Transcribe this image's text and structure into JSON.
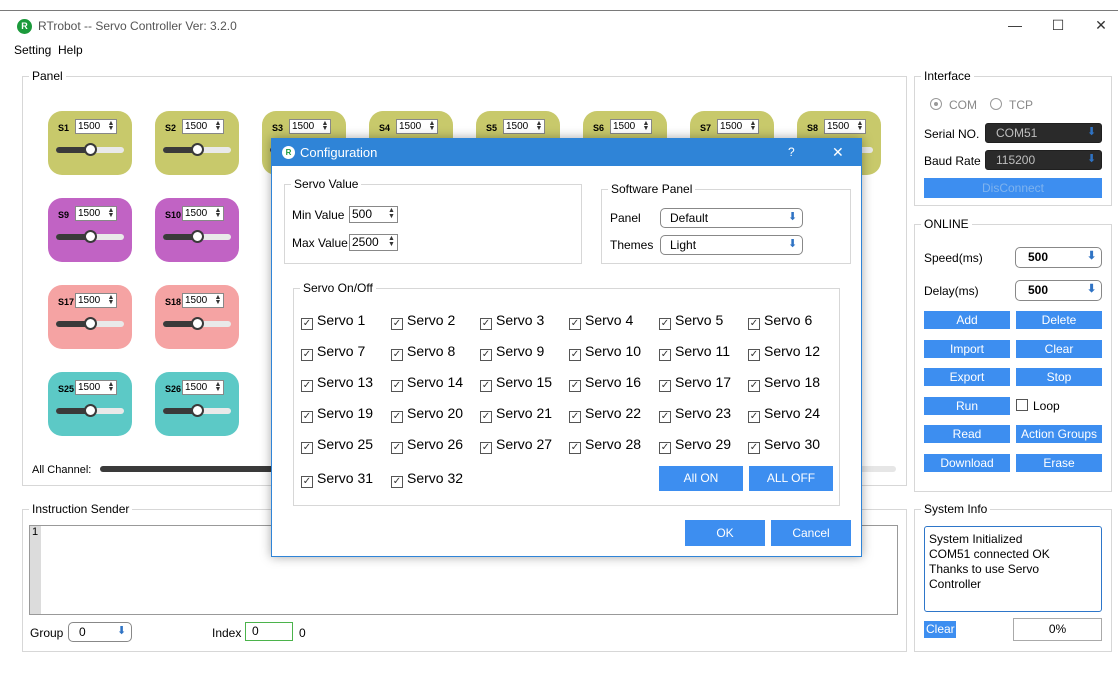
{
  "window": {
    "title": "RTrobot -- Servo Controller  Ver: 3.2.0",
    "minimize": "—",
    "maximize": "☐",
    "close": "✕"
  },
  "menu": [
    "Setting",
    "Help"
  ],
  "panel": {
    "label": "Panel",
    "all_channel_label": "All Channel:",
    "tiles": [
      {
        "label": "S1",
        "value": "1500",
        "color": "#c8c96b"
      },
      {
        "label": "S2",
        "value": "1500",
        "color": "#c8c96b"
      },
      {
        "label": "S3",
        "value": "1500",
        "color": "#c8c96b"
      },
      {
        "label": "S4",
        "value": "1500",
        "color": "#c8c96b"
      },
      {
        "label": "S5",
        "value": "1500",
        "color": "#c8c96b"
      },
      {
        "label": "S6",
        "value": "1500",
        "color": "#c8c96b"
      },
      {
        "label": "S7",
        "value": "1500",
        "color": "#c8c96b"
      },
      {
        "label": "S8",
        "value": "1500",
        "color": "#c8c96b"
      },
      {
        "label": "S9",
        "value": "1500",
        "color": "#c163c4"
      },
      {
        "label": "S10",
        "value": "1500",
        "color": "#c163c4"
      },
      {
        "label": "S17",
        "value": "1500",
        "color": "#f5a3a3"
      },
      {
        "label": "S18",
        "value": "1500",
        "color": "#f5a3a3"
      },
      {
        "label": "S25",
        "value": "1500",
        "color": "#5cc9c6"
      },
      {
        "label": "S26",
        "value": "1500",
        "color": "#5cc9c6"
      }
    ]
  },
  "instruction_sender": {
    "label": "Instruction Sender",
    "line_number": "1",
    "group_label": "Group",
    "group_value": "0",
    "index_label": "Index",
    "index_value": "0",
    "index_count": "0"
  },
  "interface": {
    "label": "Interface",
    "com_label": "COM",
    "tcp_label": "TCP",
    "serial_label": "Serial NO.",
    "serial_value": "COM51",
    "baud_label": "Baud Rate",
    "baud_value": "115200",
    "disconnect_label": "DisConnect"
  },
  "online": {
    "label": "ONLINE",
    "speed_label": "Speed(ms)",
    "speed_value": "500",
    "delay_label": "Delay(ms)",
    "delay_value": "500",
    "buttons": {
      "add": "Add",
      "delete": "Delete",
      "import": "Import",
      "clear": "Clear",
      "export": "Export",
      "stop": "Stop",
      "run": "Run",
      "loop": "Loop",
      "read": "Read",
      "action_groups": "Action Groups",
      "download": "Download",
      "erase": "Erase"
    }
  },
  "system_info": {
    "label": "System Info",
    "lines": [
      "System Initialized",
      "COM51 connected OK",
      "Thanks to use Servo",
      "Controller"
    ],
    "clear_label": "Clear",
    "progress_text": "0%"
  },
  "dialog": {
    "title": "Configuration",
    "help": "?",
    "close": "✕",
    "servo_value_label": "Servo Value",
    "min_label": "Min Value",
    "min_value": "500",
    "max_label": "Max Value",
    "max_value": "2500",
    "software_panel_label": "Software Panel",
    "panel_label": "Panel",
    "panel_value": "Default",
    "themes_label": "Themes",
    "themes_value": "Light",
    "servo_onoff_label": "Servo On/Off",
    "servos": [
      "Servo 1",
      "Servo 2",
      "Servo 3",
      "Servo 4",
      "Servo 5",
      "Servo 6",
      "Servo 7",
      "Servo 8",
      "Servo 9",
      "Servo 10",
      "Servo 11",
      "Servo 12",
      "Servo 13",
      "Servo 14",
      "Servo 15",
      "Servo 16",
      "Servo 17",
      "Servo 18",
      "Servo 19",
      "Servo 20",
      "Servo 21",
      "Servo 22",
      "Servo 23",
      "Servo 24",
      "Servo 25",
      "Servo 26",
      "Servo 27",
      "Servo 28",
      "Servo 29",
      "Servo 30",
      "Servo 31",
      "Servo 32"
    ],
    "all_on": "All ON",
    "all_off": "ALL OFF",
    "ok": "OK",
    "cancel": "Cancel"
  },
  "colors": {
    "accent": "#3d8ef0",
    "dialog_title": "#2f84d7"
  }
}
